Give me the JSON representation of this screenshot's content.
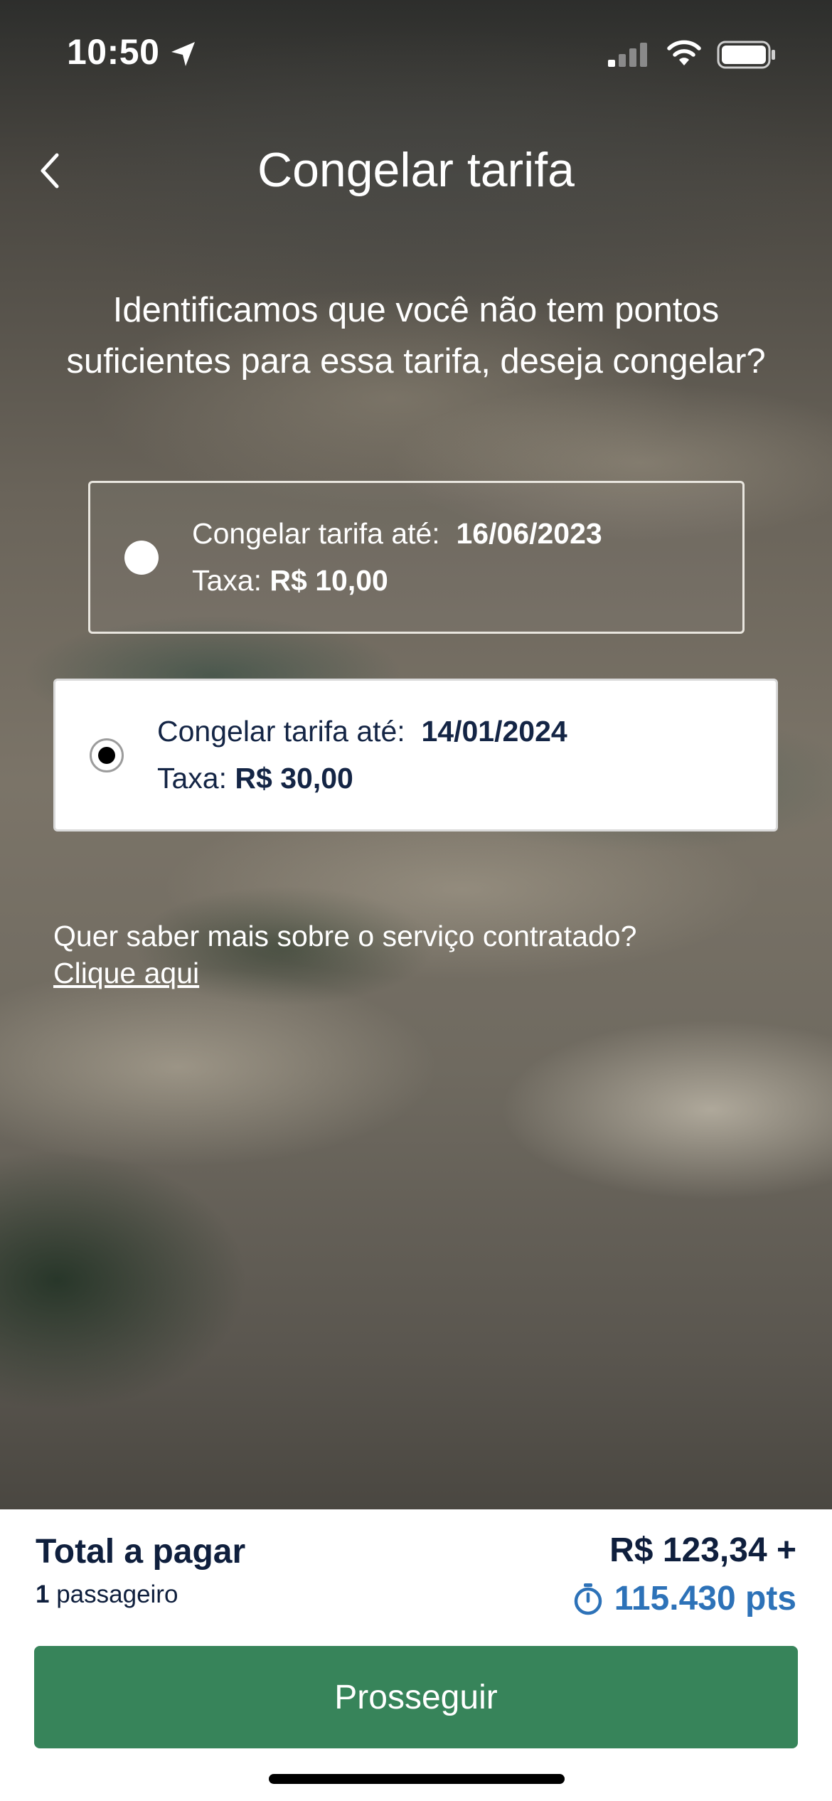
{
  "status_bar": {
    "time": "10:50",
    "icons": [
      "location-arrow-icon",
      "signal-icon",
      "wifi-icon",
      "battery-icon"
    ]
  },
  "header": {
    "title": "Congelar tarifa",
    "back_icon": "chevron-left-icon"
  },
  "intro": {
    "text": "Identificamos que você não tem pontos suficientes para essa tarifa, deseja congelar?"
  },
  "options": [
    {
      "label_until": "Congelar tarifa até:",
      "date": "16/06/2023",
      "fee_label": "Taxa:",
      "fee": "R$ 10,00",
      "selected": false
    },
    {
      "label_until": "Congelar tarifa até:",
      "date": "14/01/2024",
      "fee_label": "Taxa:",
      "fee": "R$ 30,00",
      "selected": true
    }
  ],
  "info": {
    "question": "Quer saber mais sobre o serviço contratado?",
    "link": "Clique aqui"
  },
  "footer": {
    "total_label": "Total a pagar",
    "passenger_count": "1",
    "passenger_label": "passageiro",
    "price": "R$ 123,34 +",
    "points": "115.430 pts",
    "proceed_label": "Prosseguir"
  },
  "colors": {
    "accent_green": "#37845a",
    "points_blue": "#2d72b8",
    "navy_text": "#0f1f3d"
  }
}
